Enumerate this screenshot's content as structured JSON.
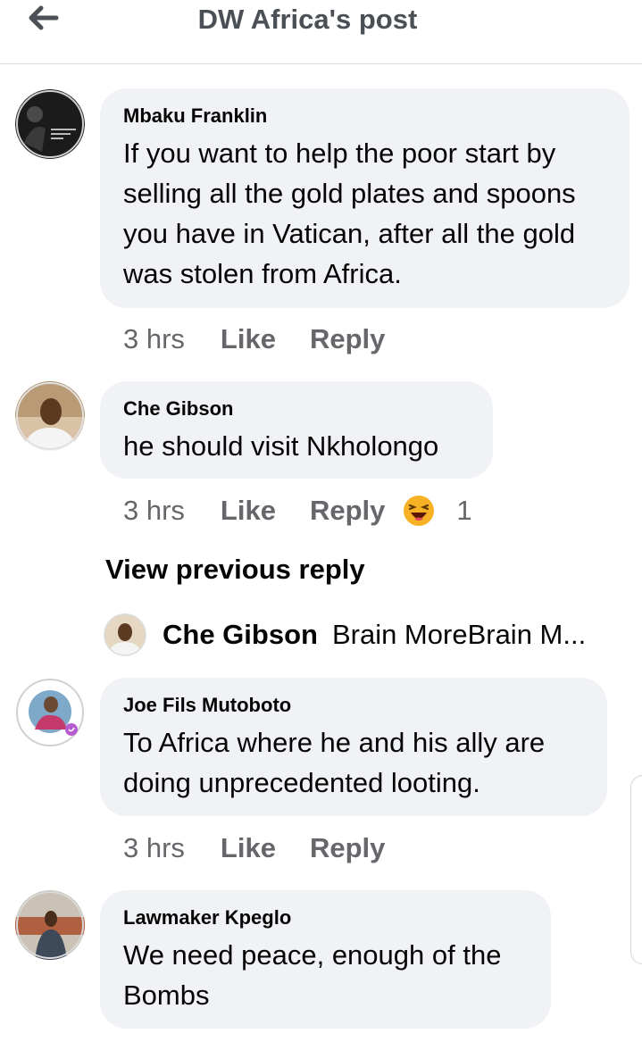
{
  "header": {
    "title": "DW Africa's post",
    "back_icon": "arrow-left-icon"
  },
  "comments": [
    {
      "author": "Mbaku Franklin",
      "text": "If you want to help the poor start by selling all the gold plates and spoons you have in Vatican, after all the gold was stolen from Africa.",
      "time": "3 hrs",
      "like": "Like",
      "reply": "Reply"
    },
    {
      "author": "Che Gibson",
      "text": "he should visit Nkholongo",
      "time": "3 hrs",
      "like": "Like",
      "reply": "Reply",
      "reaction": {
        "icon": "laughing-emoji-icon",
        "count": "1"
      }
    },
    {
      "author": "Joe Fils Mutoboto",
      "text": "To Africa where he and his ally are doing unprecedented looting.",
      "time": "3 hrs",
      "like": "Like",
      "reply": "Reply"
    },
    {
      "author": "Lawmaker Kpeglo",
      "text": "We need peace, enough of the Bombs"
    }
  ],
  "view_previous": "View previous reply",
  "reply_preview": {
    "author": "Che Gibson",
    "text": "Brain MoreBrain M..."
  },
  "colors": {
    "bubble": "#f0f2f5",
    "secondary_text": "#65676b",
    "reaction": "#f7b125"
  }
}
